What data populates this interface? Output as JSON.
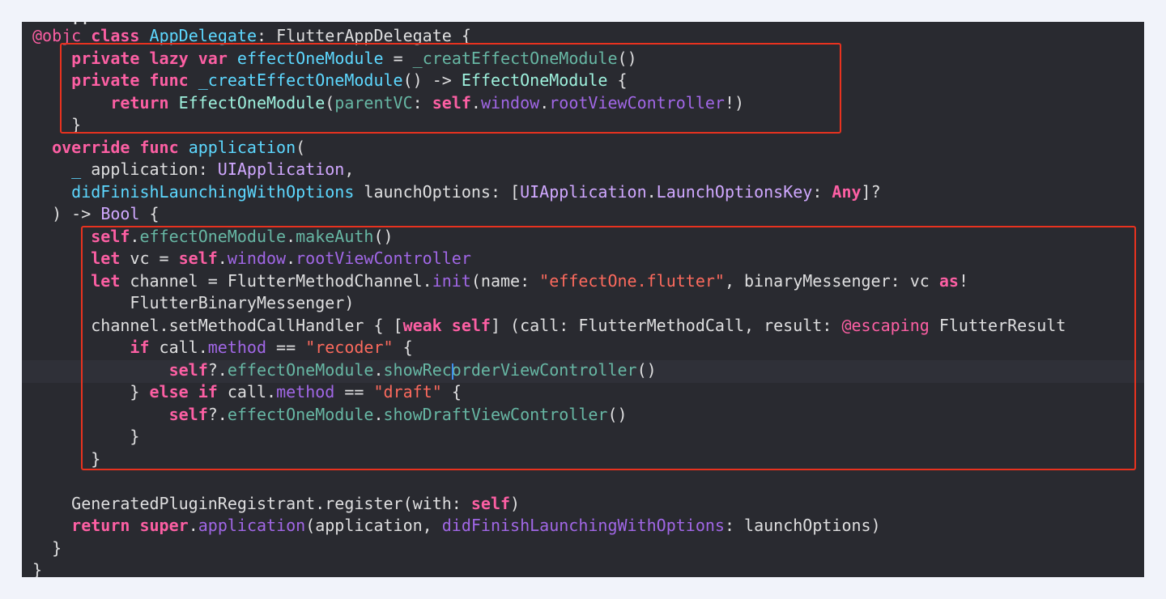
{
  "editor": {
    "clipped_top_fragment": "..",
    "clipped_bottom_fragment": "}",
    "highlight_color": "#e8321f",
    "lines": [
      {
        "indent": "",
        "tokens": [
          {
            "t": "@objc",
            "c": "at"
          },
          {
            "t": " ",
            "c": "pl"
          },
          {
            "t": "class",
            "c": "kw"
          },
          {
            "t": " ",
            "c": "pl"
          },
          {
            "t": "AppDelegate",
            "c": "fd"
          },
          {
            "t": ": FlutterAppDelegate {",
            "c": "pl"
          }
        ]
      },
      {
        "indent": "    ",
        "tokens": [
          {
            "t": "private",
            "c": "kw"
          },
          {
            "t": " ",
            "c": "pl"
          },
          {
            "t": "lazy",
            "c": "kw"
          },
          {
            "t": " ",
            "c": "pl"
          },
          {
            "t": "var",
            "c": "kw"
          },
          {
            "t": " ",
            "c": "pl"
          },
          {
            "t": "effectOneModule",
            "c": "pt"
          },
          {
            "t": " = ",
            "c": "pl"
          },
          {
            "t": "_creatEffectOneModule",
            "c": "pp"
          },
          {
            "t": "()",
            "c": "pl"
          }
        ]
      },
      {
        "indent": "    ",
        "tokens": [
          {
            "t": "private",
            "c": "kw"
          },
          {
            "t": " ",
            "c": "pl"
          },
          {
            "t": "func",
            "c": "kw"
          },
          {
            "t": " ",
            "c": "pl"
          },
          {
            "t": "_creatEffectOneModule",
            "c": "pt"
          },
          {
            "t": "() -> ",
            "c": "pl"
          },
          {
            "t": "EffectOneModule",
            "c": "tp"
          },
          {
            "t": " {",
            "c": "pl"
          }
        ]
      },
      {
        "indent": "        ",
        "tokens": [
          {
            "t": "return",
            "c": "kw"
          },
          {
            "t": " ",
            "c": "pl"
          },
          {
            "t": "EffectOneModule",
            "c": "tp"
          },
          {
            "t": "(",
            "c": "pl"
          },
          {
            "t": "parentVC",
            "c": "pp"
          },
          {
            "t": ": ",
            "c": "pl"
          },
          {
            "t": "self",
            "c": "kw"
          },
          {
            "t": ".",
            "c": "pl"
          },
          {
            "t": "window",
            "c": "pm"
          },
          {
            "t": ".",
            "c": "pl"
          },
          {
            "t": "rootViewController",
            "c": "pm"
          },
          {
            "t": "!)",
            "c": "pl"
          }
        ]
      },
      {
        "indent": "    ",
        "tokens": [
          {
            "t": "}",
            "c": "pl"
          }
        ]
      },
      {
        "indent": "  ",
        "tokens": [
          {
            "t": "override",
            "c": "kw"
          },
          {
            "t": " ",
            "c": "pl"
          },
          {
            "t": "func",
            "c": "kw"
          },
          {
            "t": " ",
            "c": "pl"
          },
          {
            "t": "application",
            "c": "pt"
          },
          {
            "t": "(",
            "c": "pl"
          }
        ]
      },
      {
        "indent": "    ",
        "tokens": [
          {
            "t": "_",
            "c": "pt"
          },
          {
            "t": " application: ",
            "c": "pl"
          },
          {
            "t": "UIApplication",
            "c": "ty"
          },
          {
            "t": ",",
            "c": "pl"
          }
        ]
      },
      {
        "indent": "    ",
        "tokens": [
          {
            "t": "didFinishLaunchingWithOptions",
            "c": "pt"
          },
          {
            "t": " launchOptions: [",
            "c": "pl"
          },
          {
            "t": "UIApplication",
            "c": "ty"
          },
          {
            "t": ".",
            "c": "pl"
          },
          {
            "t": "LaunchOptionsKey",
            "c": "ty"
          },
          {
            "t": ": ",
            "c": "pl"
          },
          {
            "t": "Any",
            "c": "kw"
          },
          {
            "t": "]?",
            "c": "pl"
          }
        ]
      },
      {
        "indent": "  ",
        "tokens": [
          {
            "t": ") -> ",
            "c": "pl"
          },
          {
            "t": "Bool",
            "c": "ty"
          },
          {
            "t": " {",
            "c": "pl"
          }
        ]
      },
      {
        "indent": "      ",
        "tokens": [
          {
            "t": "self",
            "c": "kw"
          },
          {
            "t": ".",
            "c": "pl"
          },
          {
            "t": "effectOneModule",
            "c": "pp"
          },
          {
            "t": ".",
            "c": "pl"
          },
          {
            "t": "makeAuth",
            "c": "pp"
          },
          {
            "t": "()",
            "c": "pl"
          }
        ]
      },
      {
        "indent": "      ",
        "tokens": [
          {
            "t": "let",
            "c": "kw"
          },
          {
            "t": " vc = ",
            "c": "pl"
          },
          {
            "t": "self",
            "c": "kw"
          },
          {
            "t": ".",
            "c": "pl"
          },
          {
            "t": "window",
            "c": "pm"
          },
          {
            "t": ".",
            "c": "pl"
          },
          {
            "t": "rootViewController",
            "c": "pm"
          }
        ]
      },
      {
        "indent": "      ",
        "tokens": [
          {
            "t": "let",
            "c": "kw"
          },
          {
            "t": " channel = FlutterMethodChannel.",
            "c": "pl"
          },
          {
            "t": "init",
            "c": "pm"
          },
          {
            "t": "(name: ",
            "c": "pl"
          },
          {
            "t": "\"effectOne.flutter\"",
            "c": "st"
          },
          {
            "t": ", binaryMessenger: vc ",
            "c": "pl"
          },
          {
            "t": "as",
            "c": "kw"
          },
          {
            "t": "!",
            "c": "pl"
          }
        ]
      },
      {
        "indent": "          ",
        "tokens": [
          {
            "t": "FlutterBinaryMessenger)",
            "c": "pl"
          }
        ]
      },
      {
        "indent": "      ",
        "tokens": [
          {
            "t": "channel.setMethodCallHandler { [",
            "c": "pl"
          },
          {
            "t": "weak",
            "c": "kw"
          },
          {
            "t": " ",
            "c": "pl"
          },
          {
            "t": "self",
            "c": "kw"
          },
          {
            "t": "] (call: FlutterMethodCall, result: ",
            "c": "pl"
          },
          {
            "t": "@escaping",
            "c": "at"
          },
          {
            "t": " FlutterResult",
            "c": "pl"
          }
        ]
      },
      {
        "indent": "          ",
        "tokens": [
          {
            "t": "if",
            "c": "kw"
          },
          {
            "t": " call.",
            "c": "pl"
          },
          {
            "t": "method",
            "c": "pm"
          },
          {
            "t": " == ",
            "c": "pl"
          },
          {
            "t": "\"recoder\"",
            "c": "st"
          },
          {
            "t": " {",
            "c": "pl"
          }
        ]
      },
      {
        "indent": "              ",
        "tokens": [
          {
            "t": "self",
            "c": "kw"
          },
          {
            "t": "?.",
            "c": "pl"
          },
          {
            "t": "effectOneModule",
            "c": "pp"
          },
          {
            "t": ".",
            "c": "pl"
          },
          {
            "t": "showRecorderViewController",
            "c": "pp"
          },
          {
            "t": "()",
            "c": "pl"
          }
        ]
      },
      {
        "indent": "          ",
        "tokens": [
          {
            "t": "} ",
            "c": "pl"
          },
          {
            "t": "else",
            "c": "kw"
          },
          {
            "t": " ",
            "c": "pl"
          },
          {
            "t": "if",
            "c": "kw"
          },
          {
            "t": " call.",
            "c": "pl"
          },
          {
            "t": "method",
            "c": "pm"
          },
          {
            "t": " == ",
            "c": "pl"
          },
          {
            "t": "\"draft\"",
            "c": "st"
          },
          {
            "t": " {",
            "c": "pl"
          }
        ]
      },
      {
        "indent": "              ",
        "tokens": [
          {
            "t": "self",
            "c": "kw"
          },
          {
            "t": "?.",
            "c": "pl"
          },
          {
            "t": "effectOneModule",
            "c": "pp"
          },
          {
            "t": ".",
            "c": "pl"
          },
          {
            "t": "showDraftViewController",
            "c": "pp"
          },
          {
            "t": "()",
            "c": "pl"
          }
        ]
      },
      {
        "indent": "          ",
        "tokens": [
          {
            "t": "}",
            "c": "pl"
          }
        ]
      },
      {
        "indent": "      ",
        "tokens": [
          {
            "t": "}",
            "c": "pl"
          }
        ]
      },
      {
        "indent": "",
        "tokens": []
      },
      {
        "indent": "    ",
        "tokens": [
          {
            "t": "GeneratedPluginRegistrant.register(with: ",
            "c": "pl"
          },
          {
            "t": "self",
            "c": "kw"
          },
          {
            "t": ")",
            "c": "pl"
          }
        ]
      },
      {
        "indent": "    ",
        "tokens": [
          {
            "t": "return",
            "c": "kw"
          },
          {
            "t": " ",
            "c": "pl"
          },
          {
            "t": "super",
            "c": "kw"
          },
          {
            "t": ".",
            "c": "pl"
          },
          {
            "t": "application",
            "c": "pm"
          },
          {
            "t": "(application, ",
            "c": "pl"
          },
          {
            "t": "didFinishLaunchingWithOptions",
            "c": "pm"
          },
          {
            "t": ": launchOptions)",
            "c": "pl"
          }
        ]
      },
      {
        "indent": "  ",
        "tokens": [
          {
            "t": "}",
            "c": "pl"
          }
        ]
      }
    ]
  }
}
